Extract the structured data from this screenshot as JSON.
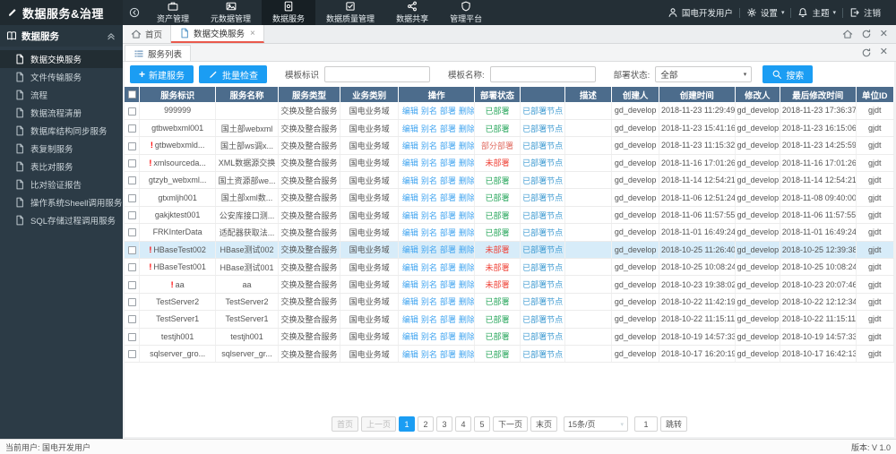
{
  "topbar": {
    "logo": "数据服务&治理",
    "nav": [
      {
        "label": "资产管理",
        "icon": "briefcase",
        "active": false
      },
      {
        "label": "元数据管理",
        "icon": "meta",
        "active": false
      },
      {
        "label": "数据服务",
        "icon": "service",
        "active": true
      },
      {
        "label": "数据质量管理",
        "icon": "quality",
        "active": false
      },
      {
        "label": "数据共享",
        "icon": "share",
        "active": false
      },
      {
        "label": "管理平台",
        "icon": "shield",
        "active": false
      }
    ],
    "user": "国电开发用户",
    "settings": "设置",
    "theme": "主题",
    "logout": "注销"
  },
  "sidebar": {
    "title": "数据服务",
    "items": [
      {
        "label": "数据交换服务",
        "active": true
      },
      {
        "label": "文件传输服务",
        "active": false
      },
      {
        "label": "流程",
        "active": false
      },
      {
        "label": "数据流程清册",
        "active": false
      },
      {
        "label": "数据库结构同步服务",
        "active": false
      },
      {
        "label": "表复制服务",
        "active": false
      },
      {
        "label": "表比对服务",
        "active": false
      },
      {
        "label": "比对验证报告",
        "active": false
      },
      {
        "label": "操作系统Sheell调用服务",
        "active": false
      },
      {
        "label": "SQL存储过程调用服务",
        "active": false
      }
    ]
  },
  "tabs": [
    {
      "label": "首页",
      "icon": "home",
      "active": false,
      "closable": false
    },
    {
      "label": "数据交换服务",
      "icon": "file",
      "active": true,
      "closable": true
    }
  ],
  "panel": {
    "tab": "服务列表"
  },
  "toolbar": {
    "new_label": "新建服务",
    "batch_label": "批量检查",
    "template_id_label": "模板标识",
    "template_name_label": "模板名称:",
    "deploy_status_label": "部署状态:",
    "deploy_status_value": "全部",
    "search_label": "搜索"
  },
  "table": {
    "headers": [
      "",
      "服务标识",
      "服务名称",
      "服务类型",
      "业务类别",
      "操作",
      "部署状态",
      "",
      "描述",
      "创建人",
      "创建时间",
      "修改人",
      "最后修改时间",
      "单位ID"
    ],
    "ops": [
      "编辑",
      "别名",
      "部署",
      "删除"
    ],
    "node_link": "已部署节点",
    "rows": [
      {
        "warn": false,
        "id": "999999",
        "name": "",
        "type": "交换及整合服务",
        "domain": "国电业务域",
        "status": "已部署",
        "st": "ok",
        "desc": "",
        "creator": "gd_develop",
        "created": "2018-11-23 11:29:49",
        "modifier": "gd_develop",
        "modified": "2018-11-23 17:36:37",
        "unit": "gjdt",
        "highlight": false
      },
      {
        "warn": false,
        "id": "gtbwebxml001",
        "name": "国土部webxml",
        "type": "交换及整合服务",
        "domain": "国电业务域",
        "status": "已部署",
        "st": "ok",
        "desc": "",
        "creator": "gd_develop",
        "created": "2018-11-23 15:41:16",
        "modifier": "gd_develop",
        "modified": "2018-11-23 16:15:06",
        "unit": "gjdt",
        "highlight": false
      },
      {
        "warn": true,
        "id": "gtbwebxmld...",
        "name": "国土部ws调x...",
        "type": "交换及整合服务",
        "domain": "国电业务域",
        "status": "部分部署",
        "st": "part",
        "desc": "",
        "creator": "gd_develop",
        "created": "2018-11-23 11:15:32",
        "modifier": "gd_develop",
        "modified": "2018-11-23 14:25:59",
        "unit": "gjdt",
        "highlight": false
      },
      {
        "warn": true,
        "id": "xmlsourceda...",
        "name": "XML数据源交换",
        "type": "交换及整合服务",
        "domain": "国电业务域",
        "status": "未部署",
        "st": "un",
        "desc": "",
        "creator": "gd_develop",
        "created": "2018-11-16 17:01:26",
        "modifier": "gd_develop",
        "modified": "2018-11-16 17:01:26",
        "unit": "gjdt",
        "highlight": false
      },
      {
        "warn": false,
        "id": "gtzyb_webxml...",
        "name": "国土资源部we...",
        "type": "交换及整合服务",
        "domain": "国电业务域",
        "status": "已部署",
        "st": "ok",
        "desc": "",
        "creator": "gd_develop",
        "created": "2018-11-14 12:54:21",
        "modifier": "gd_develop",
        "modified": "2018-11-14 12:54:21",
        "unit": "gjdt",
        "highlight": false
      },
      {
        "warn": false,
        "id": "gtxmljh001",
        "name": "国土部xml数...",
        "type": "交换及整合服务",
        "domain": "国电业务域",
        "status": "已部署",
        "st": "ok",
        "desc": "",
        "creator": "gd_develop",
        "created": "2018-11-06 12:51:24",
        "modifier": "gd_develop",
        "modified": "2018-11-08 09:40:00",
        "unit": "gjdt",
        "highlight": false
      },
      {
        "warn": false,
        "id": "gakjktest001",
        "name": "公安库接口测...",
        "type": "交换及整合服务",
        "domain": "国电业务域",
        "status": "已部署",
        "st": "ok",
        "desc": "",
        "creator": "gd_develop",
        "created": "2018-11-06 11:57:55",
        "modifier": "gd_develop",
        "modified": "2018-11-06 11:57:55",
        "unit": "gjdt",
        "highlight": false
      },
      {
        "warn": false,
        "id": "FRKInterData",
        "name": "适配器获取法...",
        "type": "交换及整合服务",
        "domain": "国电业务域",
        "status": "已部署",
        "st": "ok",
        "desc": "",
        "creator": "gd_develop",
        "created": "2018-11-01 16:49:24",
        "modifier": "gd_develop",
        "modified": "2018-11-01 16:49:24",
        "unit": "gjdt",
        "highlight": false
      },
      {
        "warn": true,
        "id": "HBaseTest002",
        "name": "HBase测试002",
        "type": "交换及整合服务",
        "domain": "国电业务域",
        "status": "未部署",
        "st": "un",
        "desc": "",
        "creator": "gd_develop",
        "created": "2018-10-25 11:26:40",
        "modifier": "gd_develop",
        "modified": "2018-10-25 12:39:38",
        "unit": "gjdt",
        "highlight": true
      },
      {
        "warn": true,
        "id": "HBaseTest001",
        "name": "HBase测试001",
        "type": "交换及整合服务",
        "domain": "国电业务域",
        "status": "未部署",
        "st": "un",
        "desc": "",
        "creator": "gd_develop",
        "created": "2018-10-25 10:08:24",
        "modifier": "gd_develop",
        "modified": "2018-10-25 10:08:24",
        "unit": "gjdt",
        "highlight": false
      },
      {
        "warn": true,
        "id": "aa",
        "name": "aa",
        "type": "交换及整合服务",
        "domain": "国电业务域",
        "status": "未部署",
        "st": "un",
        "desc": "",
        "creator": "gd_develop",
        "created": "2018-10-23 19:38:02",
        "modifier": "gd_develop",
        "modified": "2018-10-23 20:07:46",
        "unit": "gjdt",
        "highlight": false
      },
      {
        "warn": false,
        "id": "TestServer2",
        "name": "TestServer2",
        "type": "交换及整合服务",
        "domain": "国电业务域",
        "status": "已部署",
        "st": "ok",
        "desc": "",
        "creator": "gd_develop",
        "created": "2018-10-22 11:42:19",
        "modifier": "gd_develop",
        "modified": "2018-10-22 12:12:34",
        "unit": "gjdt",
        "highlight": false
      },
      {
        "warn": false,
        "id": "TestServer1",
        "name": "TestServer1",
        "type": "交换及整合服务",
        "domain": "国电业务域",
        "status": "已部署",
        "st": "ok",
        "desc": "",
        "creator": "gd_develop",
        "created": "2018-10-22 11:15:11",
        "modifier": "gd_develop",
        "modified": "2018-10-22 11:15:11",
        "unit": "gjdt",
        "highlight": false
      },
      {
        "warn": false,
        "id": "testjh001",
        "name": "testjh001",
        "type": "交换及整合服务",
        "domain": "国电业务域",
        "status": "已部署",
        "st": "ok",
        "desc": "",
        "creator": "gd_develop",
        "created": "2018-10-19 14:57:33",
        "modifier": "gd_develop",
        "modified": "2018-10-19 14:57:33",
        "unit": "gjdt",
        "highlight": false
      },
      {
        "warn": false,
        "id": "sqlserver_gro...",
        "name": "sqlserver_gr...",
        "type": "交换及整合服务",
        "domain": "国电业务域",
        "status": "已部署",
        "st": "ok",
        "desc": "",
        "creator": "gd_develop",
        "created": "2018-10-17 16:20:19",
        "modifier": "gd_develop",
        "modified": "2018-10-17 16:42:13",
        "unit": "gjdt",
        "highlight": false
      }
    ]
  },
  "pagination": {
    "first": "首页",
    "prev": "上一页",
    "pages": [
      "1",
      "2",
      "3",
      "4",
      "5"
    ],
    "active_page": "1",
    "next": "下一页",
    "last": "末页",
    "page_size": "15条/页",
    "jump_value": "1",
    "jump": "跳转"
  },
  "footer": {
    "user_label": "当前用户:",
    "user": "国电开发用户",
    "version": "版本: V 1.0"
  },
  "colors": {
    "topbar": "#242f36",
    "sidebar": "#2c3b46",
    "table_header": "#4c6c8c",
    "accent_blue": "#1b9df3",
    "link_blue": "#42a5f0",
    "status_deployed": "#26a65b",
    "status_undeployed": "#ef4136",
    "status_partial": "#e06a5f",
    "tab_active_red": "#e9594c"
  }
}
